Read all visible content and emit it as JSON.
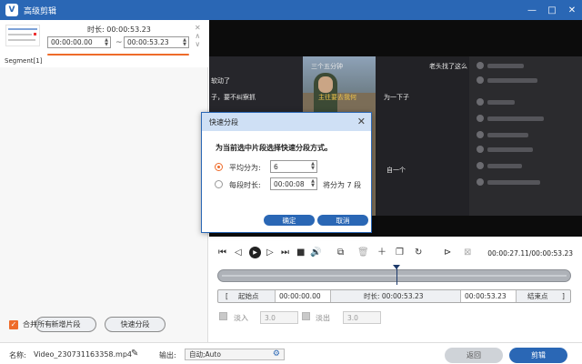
{
  "window": {
    "title": "高级剪辑",
    "logo_glyph": "V",
    "controls": {
      "minimize": "—",
      "maximize": "□",
      "close": "✕"
    }
  },
  "segment": {
    "duration_label": "时长: 00:00:53.23",
    "start": "00:00:00.00",
    "end": "00:00:53.23",
    "tilde": "~",
    "label": "Segment[1]",
    "icons": {
      "close": "✕",
      "up": "∧",
      "down": "∨"
    }
  },
  "left_buttons": {
    "add_segment": "新增片段",
    "quick_split": "快速分段"
  },
  "merge_all": {
    "label": "合并所有",
    "checked": true
  },
  "video_overlay": {
    "t1": "三个五分钟",
    "t2": "主往要去我何",
    "t3": "为一下子",
    "t4": "子，要不纠察抓",
    "t5": "老头找了这么",
    "t6": "软动了",
    "t7": "自一个"
  },
  "dialog": {
    "title": "快速分段",
    "question": "为当前选中片段选择快速分段方式。",
    "avg_label": "平均分为:",
    "avg_value": "6",
    "dur_label": "每段时长:",
    "dur_value": "00:00:08",
    "split_info": "将分为 7 段",
    "ok": "确定",
    "cancel": "取消",
    "selected": "average"
  },
  "player": {
    "time": "00:00:27.11/00:00:53.23",
    "progress": 0.509
  },
  "trim": {
    "start_label": "起始点",
    "start_value": "00:00:00.00",
    "duration_label": "时长: 00:00:53.23",
    "end_value": "00:00:53.23",
    "end_label": "结束点",
    "left_bracket": "[",
    "right_bracket": "]"
  },
  "fade": {
    "in_label": "淡入",
    "in_value": "3.0",
    "out_label": "淡出",
    "out_value": "3.0"
  },
  "bottom": {
    "name_label": "名称:",
    "file_name": "Video_230731163358.mp4",
    "output_label": "输出:",
    "output_value": "自动;Auto",
    "back": "返回",
    "cut": "剪辑"
  },
  "colors": {
    "accent": "#2a67b5",
    "orange": "#ee6b2a"
  }
}
